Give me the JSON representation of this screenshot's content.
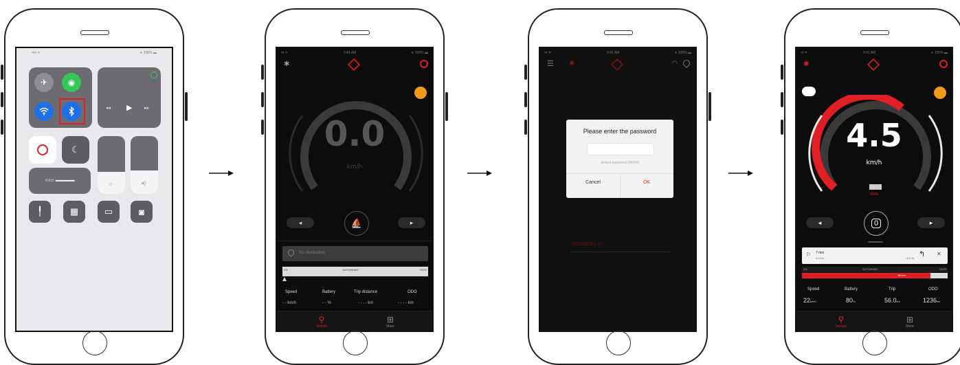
{
  "colors": {
    "accent": "#e01e26",
    "ios_blue": "#1f6fe8",
    "ios_green": "#34c759"
  },
  "arrows": [
    "→",
    "→",
    "→"
  ],
  "phone1": {
    "statusbar": {
      "left": "•••• ᯤ",
      "center": "",
      "right": "∗ 100% ▬"
    },
    "connectivity_icons": [
      "airplane-icon",
      "cellular-icon",
      "wifi-icon",
      "bluetooth-icon"
    ],
    "media": {
      "prev": "◂◂",
      "play": "▶",
      "next": "▸▸"
    },
    "mirroring_label": "▭▭ ▬▬▬▬",
    "tiles": [
      "flashlight-icon",
      "calculator-icon",
      "battery-icon",
      "camera-icon"
    ]
  },
  "phone2": {
    "statusbar": {
      "left": "•ıl ᯤ",
      "center": "9:41 AM",
      "right": "∗ 100% ▬"
    },
    "speed": "0.0",
    "unit": "km/h",
    "gear": "⛵",
    "location_placeholder": "No destination",
    "autonomy": {
      "left": "0%",
      "center": "AUTONOMY",
      "right": "100%"
    },
    "stats": [
      {
        "label": "Speed",
        "value": "- - km/h"
      },
      {
        "label": "Battery",
        "value": "- - %"
      },
      {
        "label": "Trip distance",
        "value": "- - . - km"
      },
      {
        "label": "ODO",
        "value": "- - - - km"
      }
    ],
    "tabs": [
      "Vehicle",
      "More"
    ]
  },
  "phone3": {
    "statusbar": {
      "left": "•ıl ᯤ",
      "center": "9:41 AM",
      "right": "∗ 100% ▬"
    },
    "dialog": {
      "title": "Please enter the password",
      "input_value": "",
      "hint": "default password 000000",
      "cancel": "Cancel",
      "ok": "OK"
    },
    "device_name": "SIGNEDB1-17"
  },
  "phone4": {
    "statusbar": {
      "left": "•ıl ᯤ",
      "center": "9:41 AM",
      "right": "∗ 100% ▬"
    },
    "speed": "4.5",
    "unit": "km/h",
    "battery_pct": "100%",
    "gear": "0",
    "nav": {
      "distance": "7 min",
      "sub": "0.5 km",
      "eta": "402 m"
    },
    "autonomy": {
      "left": "0%",
      "center": "AUTONOMY",
      "right": "100%",
      "fill": 0.88,
      "fill_label": "88 km"
    },
    "stats": [
      {
        "label": "Speed",
        "value": "22",
        "unit": "km/h"
      },
      {
        "label": "Battery",
        "value": "80",
        "unit": "%"
      },
      {
        "label": "Trip",
        "value": "56.0",
        "unit": "km"
      },
      {
        "label": "ODO",
        "value": "1236",
        "unit": "km"
      }
    ],
    "tabs": [
      "Vehicle",
      "More"
    ]
  }
}
